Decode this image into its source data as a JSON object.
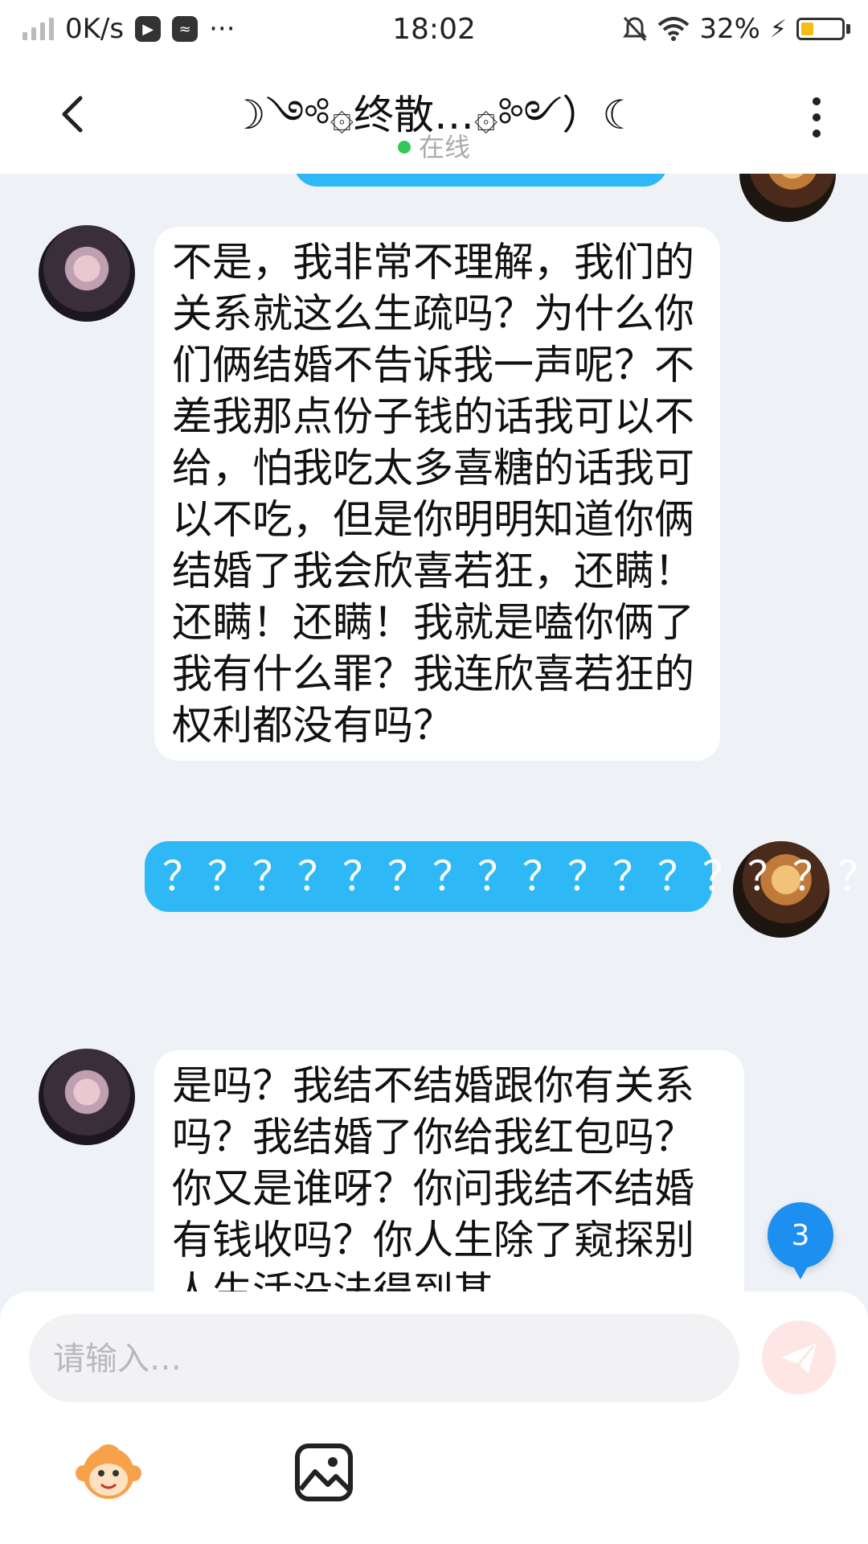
{
  "status_bar": {
    "speed": "0K/s",
    "time": "18:02",
    "battery": "32%",
    "more": "···",
    "battery_level": 0.32
  },
  "header": {
    "title": "☽༺۞终散…۞༻）☾",
    "status": "在线",
    "back_icon": "chevron-left-icon",
    "menu_icon": "vertical-dots-icon"
  },
  "messages": [
    {
      "side": "in",
      "text": "不是，我非常不理解，我们的关系就这么生疏吗？为什么你们俩结婚不告诉我一声呢？不差我那点份子钱的话我可以不给，怕我吃太多喜糖的话我可以不吃，但是你明明知道你俩结婚了我会欣喜若狂，还瞒！还瞒！还瞒！我就是嗑你俩了我有什么罪？我连欣喜若狂的权利都没有吗？"
    },
    {
      "side": "out",
      "text": "？？？？？？？？？？？？？？？？？？？？？？？？？"
    },
    {
      "side": "in",
      "text": "是吗？我结不结婚跟你有关系吗？我结婚了你给我红包吗？你又是谁呀？你问我结不结婚有钱收吗？你人生除了窥探别人生活没法得到甚"
    }
  ],
  "floating_badge": {
    "count": "3"
  },
  "input": {
    "placeholder": "请输入…",
    "send_icon": "paper-plane-icon"
  },
  "toolbar": {
    "emoji_icon": "monkey-emoji-icon",
    "image_icon": "image-icon"
  },
  "colors": {
    "outgoing_bubble": "#2fb8f6",
    "incoming_bubble": "#ffffff",
    "background": "#eef1f5",
    "online_dot": "#35c759",
    "badge": "#1c8ff0"
  }
}
